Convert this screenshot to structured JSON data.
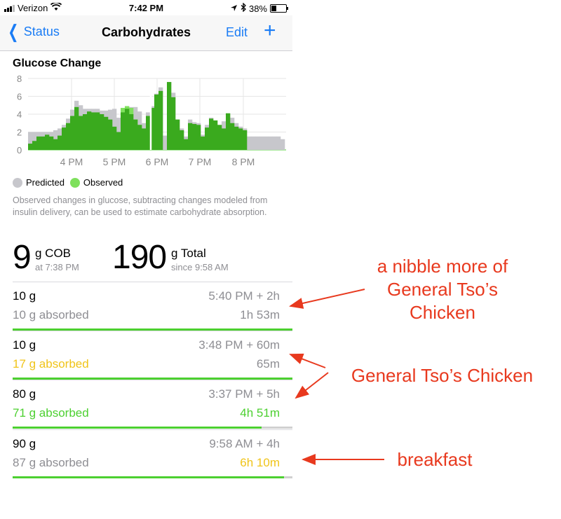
{
  "status_bar": {
    "carrier": "Verizon",
    "time": "7:42 PM",
    "battery": "38%"
  },
  "nav": {
    "back_label": "Status",
    "title": "Carbohydrates",
    "edit_label": "Edit",
    "add_label": "+"
  },
  "chart": {
    "title": "Glucose Change"
  },
  "chart_data": {
    "type": "bar",
    "title": "Glucose Change",
    "xlabel": "",
    "ylabel": "",
    "ylim": [
      0,
      8
    ],
    "yticks": [
      "0",
      "2",
      "4",
      "6",
      "8"
    ],
    "xticks": [
      "4 PM",
      "5 PM",
      "6 PM",
      "7 PM",
      "8 PM"
    ],
    "grid": true,
    "legend_placement": "bottom-left",
    "series": [
      {
        "name": "Predicted",
        "color": "#c7c7cc",
        "values": [
          2.0,
          2.0,
          2.0,
          2.0,
          2.0,
          2.0,
          2.2,
          2.4,
          2.8,
          3.5,
          4.5,
          5.5,
          5.0,
          4.6,
          4.6,
          4.6,
          4.6,
          4.4,
          4.4,
          4.5,
          4.6,
          3.6,
          2.8,
          4.4,
          4.8,
          4.8,
          4.3,
          3.0,
          4.2,
          4.9,
          6.3,
          7.0,
          1.6,
          7.6,
          6.4,
          3.4,
          2.4,
          1.5,
          3.4,
          3.1,
          3.0,
          1.7,
          2.8,
          3.6,
          2.6,
          2.6,
          3.2,
          3.9,
          3.6,
          3.0,
          2.6,
          2.4,
          1.5,
          1.5,
          1.5,
          1.5,
          1.5,
          1.5,
          1.5,
          1.5,
          1.2
        ]
      },
      {
        "name": "Observed",
        "color": "#3aaa1e",
        "values": [
          0.7,
          1.0,
          1.5,
          1.5,
          1.7,
          1.5,
          1.2,
          1.6,
          2.5,
          3.0,
          3.8,
          4.8,
          3.8,
          4.0,
          4.3,
          4.2,
          4.2,
          4.0,
          3.7,
          3.4,
          2.6,
          2.0,
          4.2,
          4.6,
          4.0,
          3.4,
          2.8,
          2.4,
          3.8,
          4.7,
          6.2,
          6.6,
          0.0,
          7.6,
          5.9,
          3.4,
          2.2,
          1.2,
          3.0,
          2.9,
          2.8,
          1.5,
          2.5,
          3.5,
          3.3,
          2.8,
          2.4,
          4.1,
          3.0,
          2.6,
          2.4,
          2.2,
          0.0,
          0.0,
          0.0,
          0.0,
          0.0,
          0.0,
          0.0,
          0.0,
          0.0
        ]
      },
      {
        "name": "Observed (light)",
        "color": "#7ee05c",
        "values": [
          0,
          0,
          0,
          0,
          0,
          0,
          0,
          0,
          0,
          0,
          0,
          0,
          0,
          0,
          0,
          0,
          0,
          0,
          0,
          0,
          0,
          0,
          4.7,
          4.9,
          4.7,
          3.4,
          2.8,
          0,
          0,
          0,
          0,
          0,
          0,
          0,
          0,
          0,
          0,
          0,
          0,
          0,
          0,
          0,
          0,
          0,
          0,
          0,
          0,
          0,
          0,
          0,
          0,
          0,
          0,
          0,
          0,
          0,
          0,
          0,
          0,
          0,
          0
        ]
      }
    ]
  },
  "legend": {
    "predicted_label": "Predicted",
    "observed_label": "Observed",
    "predicted_color": "#c7c7cc",
    "observed_color": "#7ee05c"
  },
  "description": "Observed changes in glucose, subtracting changes modeled from insulin delivery, can be used to estimate carbohydrate absorption.",
  "summary": {
    "cob_value": "9",
    "cob_unit": "g COB",
    "cob_time": "at 7:38 PM",
    "total_value": "190",
    "total_unit": "g Total",
    "total_since": "since 9:58 AM"
  },
  "entries": [
    {
      "amount": "10 g",
      "time": "5:40 PM + 2h",
      "absorbed": "10 g absorbed",
      "absorbed_color": "#8e8e93",
      "duration": "1h 53m",
      "duration_color": "#8e8e93",
      "progress": 1.0,
      "bar_color": "#4cd030"
    },
    {
      "amount": "10 g",
      "time": "3:48 PM + 60m",
      "absorbed": "17 g absorbed",
      "absorbed_color": "#f0c419",
      "duration": "65m",
      "duration_color": "#8e8e93",
      "progress": 1.0,
      "bar_color": "#4cd030"
    },
    {
      "amount": "80 g",
      "time": "3:37 PM + 5h",
      "absorbed": "71 g absorbed",
      "absorbed_color": "#4cd030",
      "duration": "4h 51m",
      "duration_color": "#4cd030",
      "progress": 0.89,
      "bar_color": "#4cd030"
    },
    {
      "amount": "90 g",
      "time": "9:58 AM + 4h",
      "absorbed": "87 g absorbed",
      "absorbed_color": "#8e8e93",
      "duration": "6h 10m",
      "duration_color": "#f0c419",
      "progress": 0.97,
      "bar_color": "#4cd030"
    }
  ],
  "annotations": {
    "nibble_line1": "a nibble more of",
    "nibble_line2": "General Tso’s",
    "nibble_line3": "Chicken",
    "tso": "General Tso’s Chicken",
    "breakfast": "breakfast",
    "color": "#e8391e"
  }
}
